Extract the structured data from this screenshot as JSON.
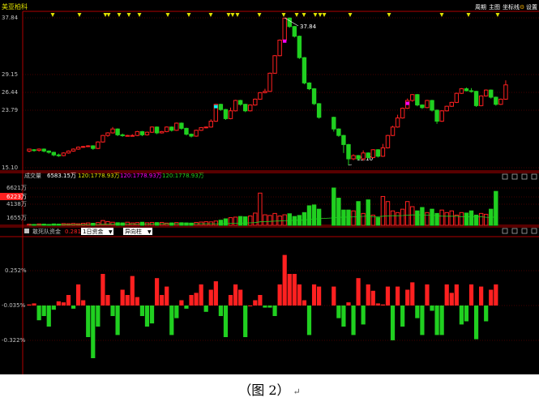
{
  "stock": {
    "name": "美亚柏科"
  },
  "toolbar": {
    "items": [
      "周期",
      "主图",
      "坐标线",
      "设置"
    ],
    "colors": {
      "text": "#ffffff",
      "bg": "#000000"
    }
  },
  "price_panel": {
    "yticks": [
      "37.84",
      "29.15",
      "26.44",
      "23.79",
      "15.10"
    ],
    "high_label": "37.84",
    "low_label": "15.10"
  },
  "volume_panel": {
    "title": "成交量",
    "value": "6583.15万",
    "ma1": "120:1778.93万",
    "ma2": "120:1778.93万",
    "ma3": "120:1778.93万",
    "yticks": [
      "6621万",
      "6223万",
      "4138万",
      "1655万"
    ]
  },
  "fund_panel": {
    "title": "敢死队资金",
    "value": "0.2815",
    "dropdown1": "1日资金",
    "dropdown2": "异向柱",
    "yticks": [
      "0.252%",
      "-0.035%",
      "-0.322%"
    ]
  },
  "caption": {
    "text": "（图 2）",
    "mark": "↵"
  },
  "colors": {
    "up": "#ff2020",
    "down": "#20d020",
    "panel_line": "#b00000",
    "grid": "#8a0000",
    "label": "#c0c0c0",
    "yellow": "#e0e000",
    "magenta": "#ff00ff",
    "cyan": "#00ffff"
  },
  "chart_data": {
    "type": "candlestick",
    "candles": [
      [
        17.3,
        17.6,
        17.1,
        17.5
      ],
      [
        17.5,
        17.4,
        17.2,
        17.6
      ],
      [
        17.4,
        17.6,
        17.2,
        17.7
      ],
      [
        17.6,
        17.3,
        17.1,
        17.7
      ],
      [
        17.3,
        17.1,
        16.9,
        17.4
      ],
      [
        17.1,
        16.7,
        16.5,
        17.2
      ],
      [
        16.7,
        16.6,
        16.4,
        16.9
      ],
      [
        16.6,
        17.0,
        16.5,
        17.1
      ],
      [
        17.0,
        17.3,
        16.9,
        17.4
      ],
      [
        17.3,
        17.6,
        17.2,
        17.7
      ],
      [
        17.6,
        17.9,
        17.5,
        18.0
      ],
      [
        17.9,
        18.0,
        17.8,
        18.1
      ],
      [
        18.0,
        18.1,
        17.9,
        18.2
      ],
      [
        18.1,
        17.7,
        17.5,
        18.2
      ],
      [
        17.7,
        18.7,
        17.6,
        18.8
      ],
      [
        18.7,
        19.7,
        18.6,
        19.8
      ],
      [
        19.7,
        20.1,
        19.5,
        20.2
      ],
      [
        20.1,
        20.7,
        20.0,
        21.0
      ],
      [
        20.7,
        19.8,
        19.6,
        20.8
      ],
      [
        19.8,
        19.7,
        19.5,
        20.0
      ],
      [
        19.7,
        19.7,
        19.6,
        19.8
      ],
      [
        19.7,
        19.7,
        19.6,
        19.9
      ],
      [
        19.7,
        20.3,
        19.6,
        20.4
      ],
      [
        20.3,
        19.8,
        19.6,
        20.4
      ],
      [
        19.8,
        20.2,
        19.7,
        20.3
      ],
      [
        20.2,
        21.0,
        20.1,
        21.1
      ],
      [
        21.0,
        20.1,
        19.9,
        21.1
      ],
      [
        20.1,
        20.3,
        20.0,
        20.4
      ],
      [
        20.3,
        21.0,
        20.2,
        21.1
      ],
      [
        21.0,
        20.5,
        20.3,
        21.1
      ],
      [
        20.5,
        21.6,
        20.4,
        21.7
      ],
      [
        21.6,
        20.8,
        20.6,
        21.7
      ],
      [
        20.8,
        19.9,
        19.7,
        20.9
      ],
      [
        19.9,
        19.6,
        19.4,
        20.0
      ],
      [
        19.6,
        20.5,
        19.5,
        20.6
      ],
      [
        20.5,
        20.9,
        20.4,
        21.0
      ],
      [
        20.9,
        21.0,
        20.8,
        21.1
      ],
      [
        21.0,
        21.9,
        20.9,
        22.2
      ],
      [
        21.9,
        24.5,
        21.8,
        24.6
      ],
      [
        24.5,
        23.7,
        23.5,
        24.6
      ],
      [
        23.7,
        22.3,
        22.1,
        23.8
      ],
      [
        22.3,
        23.5,
        22.2,
        24.0
      ],
      [
        23.5,
        25.1,
        23.4,
        25.2
      ],
      [
        25.1,
        24.5,
        24.3,
        25.2
      ],
      [
        24.5,
        23.5,
        23.3,
        24.6
      ],
      [
        23.5,
        24.4,
        23.4,
        24.5
      ],
      [
        24.4,
        25.3,
        24.3,
        25.4
      ],
      [
        25.3,
        26.3,
        25.2,
        26.4
      ],
      [
        26.3,
        26.5,
        26.2,
        26.9
      ],
      [
        26.5,
        29.3,
        26.4,
        29.4
      ],
      [
        29.3,
        32.0,
        29.2,
        32.1
      ],
      [
        32.0,
        34.4,
        31.9,
        34.5
      ],
      [
        34.4,
        37.8,
        34.3,
        37.84
      ],
      [
        37.8,
        36.5,
        36.3,
        37.9
      ],
      [
        36.5,
        35.0,
        34.8,
        36.6
      ],
      [
        35.0,
        31.7,
        31.5,
        35.1
      ],
      [
        31.7,
        27.8,
        27.6,
        31.8
      ],
      [
        27.8,
        26.9,
        26.7,
        27.9
      ],
      [
        26.9,
        24.6,
        24.4,
        27.0
      ],
      [
        24.6,
        22.5,
        22.3,
        24.7
      ],
      [
        22.5,
        20.7,
        20.3,
        22.6
      ],
      [
        20.7,
        19.7,
        19.5,
        20.8
      ],
      [
        19.7,
        18.3,
        17.0,
        19.8
      ],
      [
        18.3,
        16.1,
        15.1,
        18.4
      ],
      [
        16.1,
        16.6,
        15.9,
        16.8
      ],
      [
        16.6,
        16.1,
        15.9,
        16.7
      ],
      [
        16.1,
        17.0,
        15.8,
        17.4
      ],
      [
        17.0,
        16.3,
        16.1,
        17.1
      ],
      [
        16.3,
        17.5,
        16.2,
        17.6
      ],
      [
        17.5,
        16.5,
        16.3,
        17.6
      ],
      [
        16.5,
        17.8,
        16.4,
        18.4
      ],
      [
        17.8,
        19.7,
        17.7,
        19.8
      ],
      [
        19.7,
        21.0,
        19.6,
        21.2
      ],
      [
        21.0,
        22.4,
        20.9,
        22.9
      ],
      [
        22.4,
        23.9,
        22.3,
        24.0
      ],
      [
        23.9,
        25.1,
        23.8,
        25.4
      ],
      [
        25.1,
        26.0,
        24.9,
        26.1
      ],
      [
        26.0,
        24.4,
        24.2,
        26.1
      ],
      [
        24.4,
        24.0,
        23.8,
        24.5
      ],
      [
        24.0,
        25.1,
        23.9,
        25.2
      ],
      [
        25.1,
        23.6,
        23.4,
        25.2
      ],
      [
        23.6,
        21.9,
        21.5,
        23.7
      ],
      [
        21.9,
        23.5,
        21.8,
        23.6
      ],
      [
        23.5,
        24.2,
        23.4,
        24.3
      ],
      [
        24.2,
        24.8,
        24.1,
        24.9
      ],
      [
        24.8,
        26.2,
        24.7,
        26.3
      ],
      [
        26.2,
        26.9,
        26.1,
        27.0
      ],
      [
        26.9,
        26.6,
        26.5,
        27.1
      ],
      [
        26.6,
        26.5,
        26.3,
        27.0
      ],
      [
        26.5,
        24.3,
        24.1,
        26.6
      ],
      [
        24.3,
        25.8,
        24.2,
        25.9
      ],
      [
        25.8,
        26.7,
        25.7,
        26.8
      ],
      [
        26.7,
        25.6,
        25.4,
        26.8
      ],
      [
        25.6,
        24.5,
        24.3,
        25.7
      ],
      [
        24.5,
        25.3,
        24.4,
        25.4
      ],
      [
        25.3,
        27.5,
        25.2,
        28.2
      ]
    ],
    "gap_after_index": 59,
    "volume": [
      6,
      5,
      8,
      7,
      5,
      8,
      7,
      10,
      9,
      11,
      9,
      12,
      14,
      12,
      16,
      28,
      22,
      18,
      15,
      14,
      18,
      14,
      16,
      18,
      15,
      17,
      16,
      17,
      13,
      14,
      16,
      15,
      14,
      13,
      17,
      19,
      21,
      20,
      25,
      30,
      38,
      45,
      48,
      52,
      50,
      55,
      72,
      190,
      62,
      58,
      70,
      55,
      62,
      68,
      52,
      58,
      75,
      115,
      120,
      95,
      220,
      160,
      90,
      90,
      85,
      140,
      70,
      150,
      60,
      45,
      170,
      140,
      85,
      75,
      95,
      140,
      110,
      85,
      105,
      75,
      95,
      70,
      90,
      75,
      85,
      60,
      75,
      72,
      85,
      60,
      70,
      65,
      95,
      200
    ],
    "fund": [
      0.01,
      0.02,
      -0.14,
      -0.1,
      -0.2,
      -0.04,
      0.04,
      0.03,
      0.1,
      -0.03,
      0.2,
      0.05,
      -0.3,
      -0.5,
      -0.2,
      0.3,
      0.1,
      -0.1,
      -0.28,
      0.15,
      0.1,
      0.28,
      0.08,
      -0.1,
      -0.2,
      -0.17,
      0.26,
      0.1,
      0.18,
      -0.28,
      -0.12,
      0.05,
      -0.03,
      0.1,
      0.12,
      0.2,
      -0.06,
      0.15,
      0.23,
      -0.1,
      -0.3,
      0.1,
      0.2,
      0.15,
      -0.3,
      0,
      0.05,
      0.1,
      -0.02,
      -0.02,
      -0.1,
      0.2,
      0.48,
      0.3,
      0.3,
      0.2,
      0.05,
      -0.28,
      0.2,
      0.18,
      0.18,
      -0.12,
      -0.2,
      0.03,
      -0.28,
      0.26,
      -0.18,
      0.2,
      0.14,
      0.02,
      0.01,
      0.18,
      -0.33,
      0.18,
      -0.2,
      0.15,
      0.22,
      -0.12,
      -0.28,
      0.2,
      -0.05,
      -0.28,
      -0.28,
      0.2,
      0.12,
      0.2,
      -0.18,
      -0.15,
      0.2,
      -0.32,
      0.18,
      -0.15,
      0.15,
      0.2
    ]
  }
}
